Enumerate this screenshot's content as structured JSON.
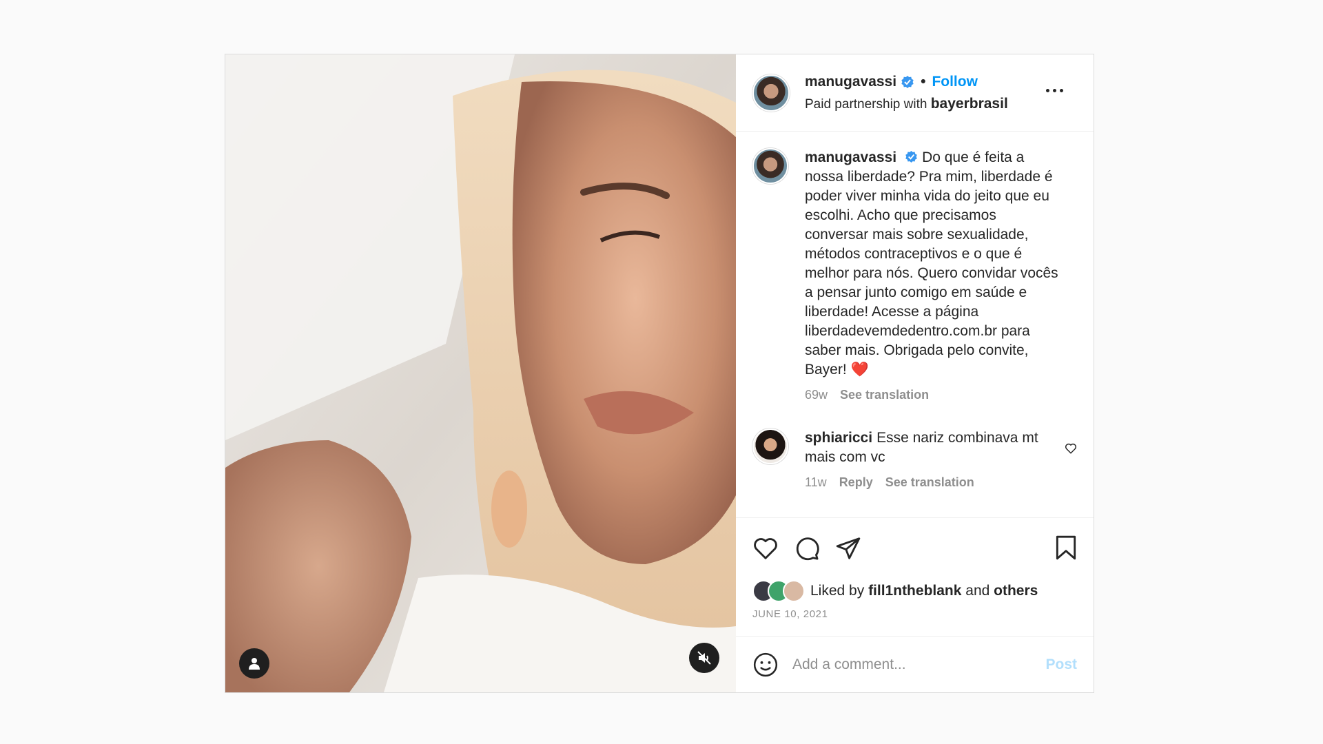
{
  "post": {
    "author": "manugavassi",
    "follow_label": "Follow",
    "dot": "•",
    "partnership_prefix": "Paid partnership with",
    "partner": "bayerbrasil",
    "caption": {
      "username": "manugavassi",
      "text": "Do que é feita a nossa liberdade? Pra mim, liberdade é poder viver minha vida do jeito que eu escolhi. Acho que precisamos conversar mais sobre sexualidade, métodos contraceptivos e o que é melhor para nós. Quero convidar vocês a pensar junto comigo em saúde e liberdade! Acesse a página liberdadevemdedentro.com.br para saber mais. Obrigada pelo convite, Bayer! ❤️",
      "age": "69w",
      "see_translation": "See translation"
    },
    "comment": {
      "username": "sphiaricci",
      "text": "Esse nariz combinava mt mais com vc",
      "age": "11w",
      "reply": "Reply",
      "see_translation": "See translation"
    },
    "likes": {
      "prefix": "Liked by",
      "user": "fill1ntheblank",
      "conjunction": "and",
      "others": "others"
    },
    "date": "JUNE 10, 2021",
    "add_comment": {
      "placeholder": "Add a comment...",
      "post_label": "Post"
    }
  },
  "icons": {
    "verified": "verified-badge-icon",
    "more": "more-options-icon",
    "like": "heart-icon",
    "comment": "comment-icon",
    "share": "share-icon",
    "save": "bookmark-icon",
    "emoji": "emoji-icon",
    "user_tag": "user-icon",
    "mute": "muted-speaker-icon"
  },
  "colors": {
    "accent": "#0095f6",
    "post_disabled": "#b2dffc",
    "muted_text": "#8e8e8e",
    "text": "#262626"
  }
}
